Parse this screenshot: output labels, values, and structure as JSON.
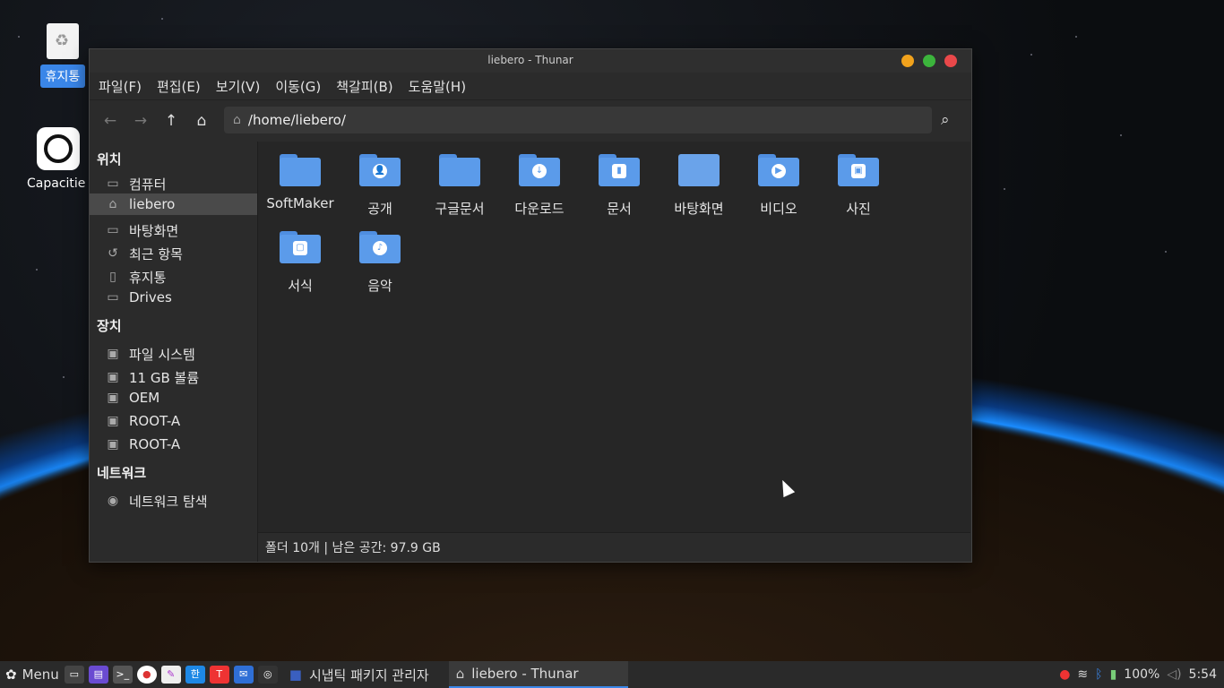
{
  "desktop": {
    "icons": [
      {
        "label": "휴지통",
        "icon": "trash-icon"
      },
      {
        "label": "Capacitie",
        "icon": "capacities-icon"
      }
    ]
  },
  "window": {
    "title": "liebero - Thunar",
    "menu": [
      "파일(F)",
      "편집(E)",
      "보기(V)",
      "이동(G)",
      "책갈피(B)",
      "도움말(H)"
    ],
    "location": "/home/liebero/",
    "toolbar_icons": [
      "back-icon",
      "forward-icon",
      "up-icon",
      "home-icon",
      "search-icon"
    ]
  },
  "sidebar": {
    "places_header": "위치",
    "places": [
      {
        "label": "컴퓨터",
        "icon": "computer-icon"
      },
      {
        "label": "liebero",
        "icon": "home-icon"
      },
      {
        "label": "바탕화면",
        "icon": "desktop-icon"
      },
      {
        "label": "최근 항목",
        "icon": "recent-icon"
      },
      {
        "label": "휴지통",
        "icon": "trash-icon"
      },
      {
        "label": "Drives",
        "icon": "drive-icon"
      }
    ],
    "devices_header": "장치",
    "devices": [
      {
        "label": "파일 시스템",
        "icon": "disk-icon"
      },
      {
        "label": "11 GB 볼륨",
        "icon": "disk-icon"
      },
      {
        "label": "OEM",
        "icon": "disk-icon"
      },
      {
        "label": "ROOT-A",
        "icon": "disk-icon"
      },
      {
        "label": "ROOT-A",
        "icon": "disk-icon"
      }
    ],
    "network_header": "네트워크",
    "network": [
      {
        "label": "네트워크 탐색",
        "icon": "network-icon"
      }
    ]
  },
  "folders": [
    {
      "name": "SoftMaker",
      "emblem": ""
    },
    {
      "name": "공개",
      "emblem": "👤"
    },
    {
      "name": "구글문서",
      "emblem": ""
    },
    {
      "name": "다운로드",
      "emblem": "↓"
    },
    {
      "name": "문서",
      "emblem": "▮"
    },
    {
      "name": "바탕화면",
      "emblem": ""
    },
    {
      "name": "비디오",
      "emblem": "▶"
    },
    {
      "name": "사진",
      "emblem": "▣"
    },
    {
      "name": "서식",
      "emblem": "▢"
    },
    {
      "name": "음악",
      "emblem": "♪"
    }
  ],
  "statusbar": "폴더 10개  |  남은 공간: 97.9 GB",
  "taskbar": {
    "menu_label": "Menu",
    "tasks": [
      "시냅틱 패키지 관리자",
      "liebero - Thunar"
    ],
    "battery": "100%",
    "clock": "5:54"
  }
}
